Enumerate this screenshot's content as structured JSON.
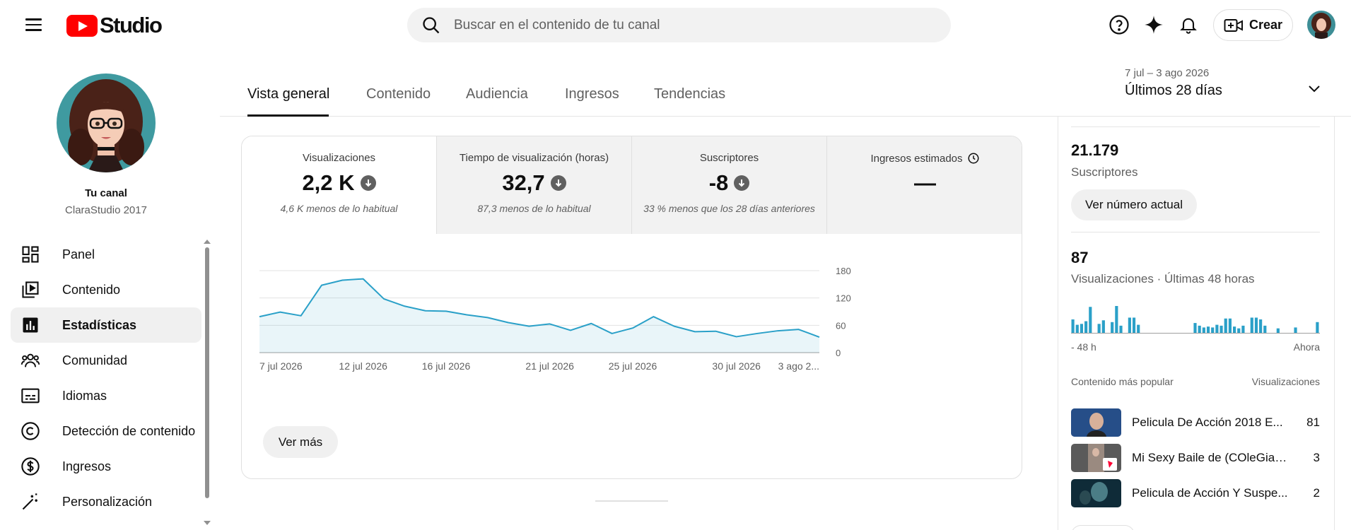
{
  "header": {
    "logo_text": "Studio",
    "search_placeholder": "Buscar en el contenido de tu canal",
    "create_label": "Crear"
  },
  "channel": {
    "title": "Tu canal",
    "name": "ClaraStudio 2017"
  },
  "nav": {
    "items": [
      {
        "label": "Panel",
        "icon": "dashboard-icon"
      },
      {
        "label": "Contenido",
        "icon": "content-icon"
      },
      {
        "label": "Estadísticas",
        "icon": "analytics-icon",
        "active": true
      },
      {
        "label": "Comunidad",
        "icon": "community-icon"
      },
      {
        "label": "Idiomas",
        "icon": "subtitles-icon"
      },
      {
        "label": "Detección de contenido",
        "icon": "copyright-icon"
      },
      {
        "label": "Ingresos",
        "icon": "dollar-icon"
      },
      {
        "label": "Personalización",
        "icon": "magic-wand-icon"
      }
    ]
  },
  "tabs": [
    "Vista general",
    "Contenido",
    "Audiencia",
    "Ingresos",
    "Tendencias"
  ],
  "date_picker": {
    "range": "7 jul – 3 ago 2026",
    "label": "Últimos 28 días"
  },
  "metrics": [
    {
      "label": "Visualizaciones",
      "value": "2,2 K",
      "compare": "4,6 K menos de lo habitual"
    },
    {
      "label": "Tiempo de visualización (horas)",
      "value": "32,7",
      "compare": "87,3 menos de lo habitual"
    },
    {
      "label": "Suscriptores",
      "value": "-8",
      "compare": "33 % menos que los 28 días anteriores"
    },
    {
      "label": "Ingresos estimados",
      "value": "—",
      "compare": ""
    }
  ],
  "see_more_label": "Ver más",
  "chart_data": {
    "type": "area",
    "x": [
      "7 jul 2026",
      "8 jul 2026",
      "9 jul 2026",
      "10 jul 2026",
      "11 jul 2026",
      "12 jul 2026",
      "13 jul 2026",
      "14 jul 2026",
      "15 jul 2026",
      "16 jul 2026",
      "17 jul 2026",
      "18 jul 2026",
      "19 jul 2026",
      "20 jul 2026",
      "21 jul 2026",
      "22 jul 2026",
      "23 jul 2026",
      "24 jul 2026",
      "25 jul 2026",
      "26 jul 2026",
      "27 jul 2026",
      "28 jul 2026",
      "29 jul 2026",
      "30 jul 2026",
      "31 jul 2026",
      "1 ago 2026",
      "2 ago 2026",
      "3 ago 2026"
    ],
    "series": [
      {
        "values": [
          79,
          89,
          81,
          148,
          159,
          162,
          118,
          102,
          92,
          91,
          83,
          77,
          66,
          58,
          63,
          49,
          64,
          42,
          54,
          79,
          58,
          46,
          47,
          35,
          42,
          48,
          51,
          34
        ]
      }
    ],
    "tick_labels": [
      "7 jul 2026",
      "12 jul 2026",
      "16 jul 2026",
      "21 jul 2026",
      "25 jul 2026",
      "30 jul 2026",
      "3 ago 2..."
    ],
    "yticks": [
      0,
      60,
      120,
      180
    ],
    "ylim": [
      0,
      180
    ],
    "grid": true,
    "color": "#2aa0c8"
  },
  "right_panel": {
    "subscribers_value": "21.179",
    "subscribers_label": "Suscriptores",
    "subscribers_button": "Ver número actual",
    "views_value": "87",
    "views_label": "Visualizaciones · Últimas 48 horas",
    "bars": [
      15,
      9,
      10,
      13,
      29,
      0,
      10,
      14,
      0,
      12,
      30,
      8,
      0,
      17,
      17,
      9,
      0,
      0,
      0,
      0,
      0,
      0,
      0,
      0,
      0,
      0,
      0,
      0,
      11,
      8,
      6,
      7,
      6,
      9,
      8,
      16,
      16,
      7,
      5,
      8,
      0,
      17,
      17,
      15,
      8,
      0,
      0,
      5,
      0,
      0,
      0,
      6,
      0,
      0,
      0,
      0,
      12
    ],
    "bars_left_label": "- 48 h",
    "bars_right_label": "Ahora",
    "top_content_label": "Contenido más popular",
    "top_views_label": "Visualizaciones",
    "top_content": [
      {
        "title": "Pelicula De Acción 2018 E...",
        "views": "81"
      },
      {
        "title": "Mi Sexy Baile de (COleGiaLa)",
        "views": "3"
      },
      {
        "title": "Pelicula de Acción Y Suspe...",
        "views": "2"
      }
    ]
  },
  "colors": {
    "accent": "#2aa0c8",
    "brand_red": "#ff0000"
  }
}
